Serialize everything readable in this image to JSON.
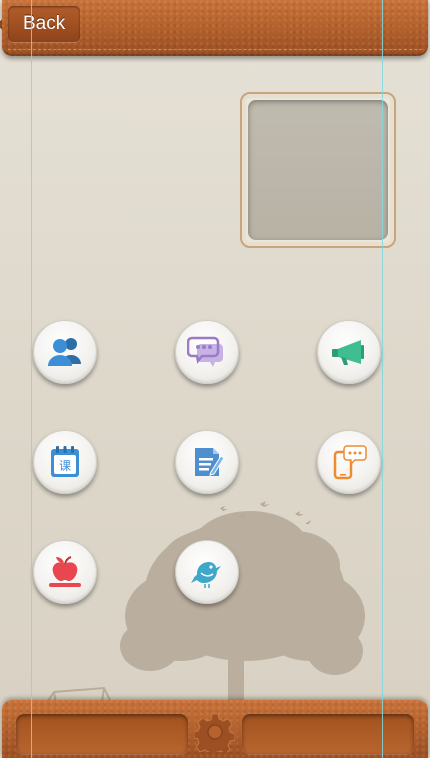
{
  "header": {
    "back_label": "Back"
  },
  "icons": [
    {
      "name": "contacts-icon"
    },
    {
      "name": "chat-icon"
    },
    {
      "name": "megaphone-icon"
    },
    {
      "name": "calendar-class-icon",
      "glyph": "课"
    },
    {
      "name": "notes-edit-icon"
    },
    {
      "name": "phone-message-icon"
    },
    {
      "name": "apple-icon"
    },
    {
      "name": "bird-icon"
    }
  ],
  "footer": {
    "settings_icon": "gear-icon"
  },
  "colors": {
    "leather": "#b6622d",
    "background": "#e6e1d6",
    "guide": "#7fd7df",
    "blue": "#3c8fd6",
    "purple": "#9a7bc6",
    "green": "#3fbf91",
    "red": "#e8474f"
  }
}
